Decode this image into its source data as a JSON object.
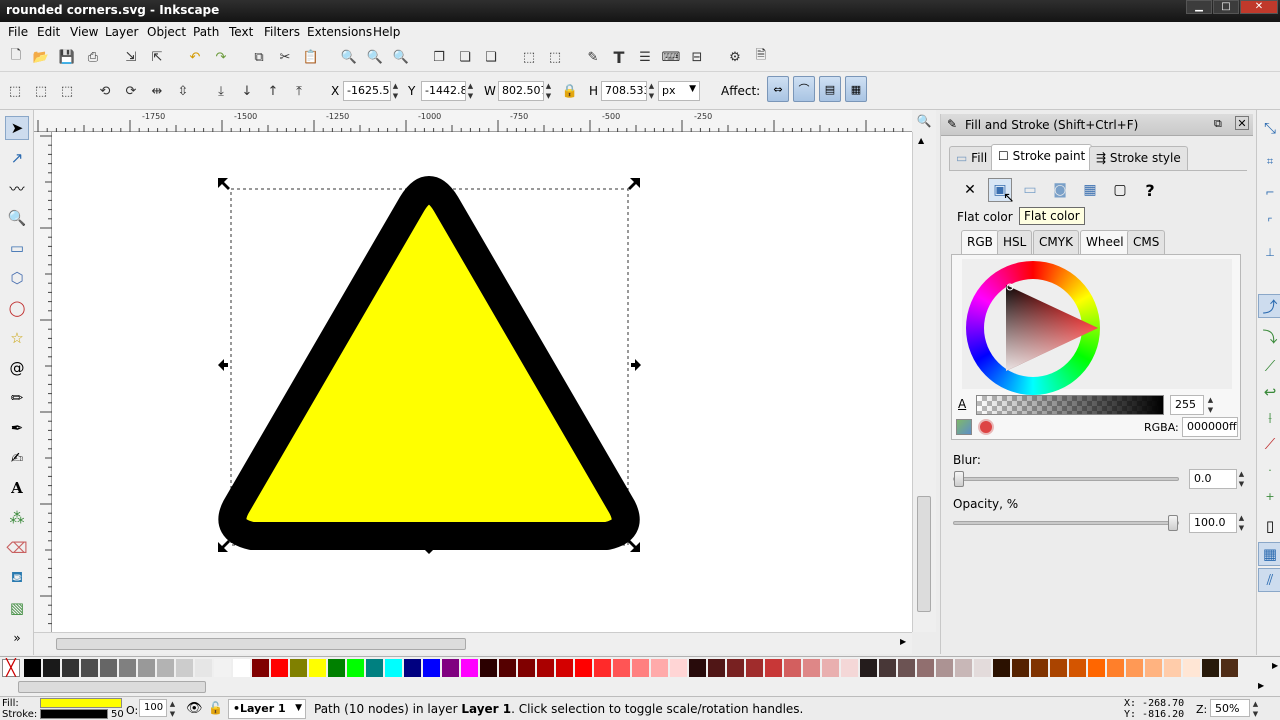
{
  "window": {
    "title": "rounded corners.svg - Inkscape"
  },
  "menu": [
    "File",
    "Edit",
    "View",
    "Layer",
    "Object",
    "Path",
    "Text",
    "Filters",
    "Extensions",
    "Help"
  ],
  "toolcontrols": {
    "x_label": "X",
    "x_value": "-1625.5",
    "y_label": "Y",
    "y_value": "-1442.8",
    "w_label": "W",
    "w_value": "802.507",
    "h_label": "H",
    "h_value": "708.533",
    "unit": "px",
    "affect_label": "Affect:"
  },
  "ruler": {
    "ticks": [
      "-1750",
      "-1500",
      "-1250",
      "-1000",
      "-750",
      "-500",
      "-250"
    ]
  },
  "fill_stroke": {
    "title": "Fill and Stroke (Shift+Ctrl+F)",
    "tabs": [
      "Fill",
      "Stroke paint",
      "Stroke style"
    ],
    "active_tab": "Stroke paint",
    "tooltip": "Flat color",
    "mode_label": "Flat color",
    "color_tabs": [
      "RGB",
      "HSL",
      "CMYK",
      "Wheel",
      "CMS"
    ],
    "active_color_tab": "Wheel",
    "alpha_label": "A",
    "alpha_value": "255",
    "rgba_label": "RGBA:",
    "rgba_value": "000000ff",
    "blur_label": "Blur:",
    "blur_value": "0.0",
    "opacity_label": "Opacity, %",
    "opacity_value": "100.0"
  },
  "palette": {
    "colors": [
      "#000000",
      "#1a1a1a",
      "#333333",
      "#4d4d4d",
      "#666666",
      "#808080",
      "#999999",
      "#b3b3b3",
      "#cccccc",
      "#e6e6e6",
      "#f2f2f2",
      "#ffffff",
      "#800000",
      "#ff0000",
      "#808000",
      "#ffff00",
      "#008000",
      "#00ff00",
      "#008080",
      "#00ffff",
      "#000080",
      "#0000ff",
      "#800080",
      "#ff00ff",
      "#2b0000",
      "#550000",
      "#800000",
      "#aa0000",
      "#d40000",
      "#ff0000",
      "#ff2a2a",
      "#ff5555",
      "#ff8080",
      "#ffaaaa",
      "#ffd5d5",
      "#280b0b",
      "#501616",
      "#782121",
      "#a02c2c",
      "#c83737",
      "#d35f5f",
      "#de8787",
      "#e9afaf",
      "#f4d7d7",
      "#241c1c",
      "#483737",
      "#6c5353",
      "#916f6f",
      "#ac9393",
      "#c8b7b7",
      "#e3dbdb",
      "#2b1100",
      "#552200",
      "#803300",
      "#aa4400",
      "#d45500",
      "#ff6600",
      "#ff7f2a",
      "#ff9955",
      "#ffb380",
      "#ffccaa",
      "#ffe6d5",
      "#281a0b",
      "#502d16"
    ]
  },
  "status": {
    "fill_label": "Fill:",
    "stroke_label": "Stroke:",
    "fill_color": "#ffff00",
    "stroke_color": "#000000",
    "stroke_width": "50",
    "opacity_label": "O:",
    "opacity_value": "100",
    "layer": "•Layer 1",
    "message_pre": "Path (10 nodes) in layer ",
    "message_layer": "Layer 1",
    "message_post": ". Click selection to toggle scale/rotation handles.",
    "x_coord": "X: -268.70",
    "y_coord": "Y: -816.20",
    "zoom_label": "Z:",
    "zoom_value": "50%"
  },
  "triangle": {
    "fill": "#ffff00",
    "stroke": "#000000"
  }
}
